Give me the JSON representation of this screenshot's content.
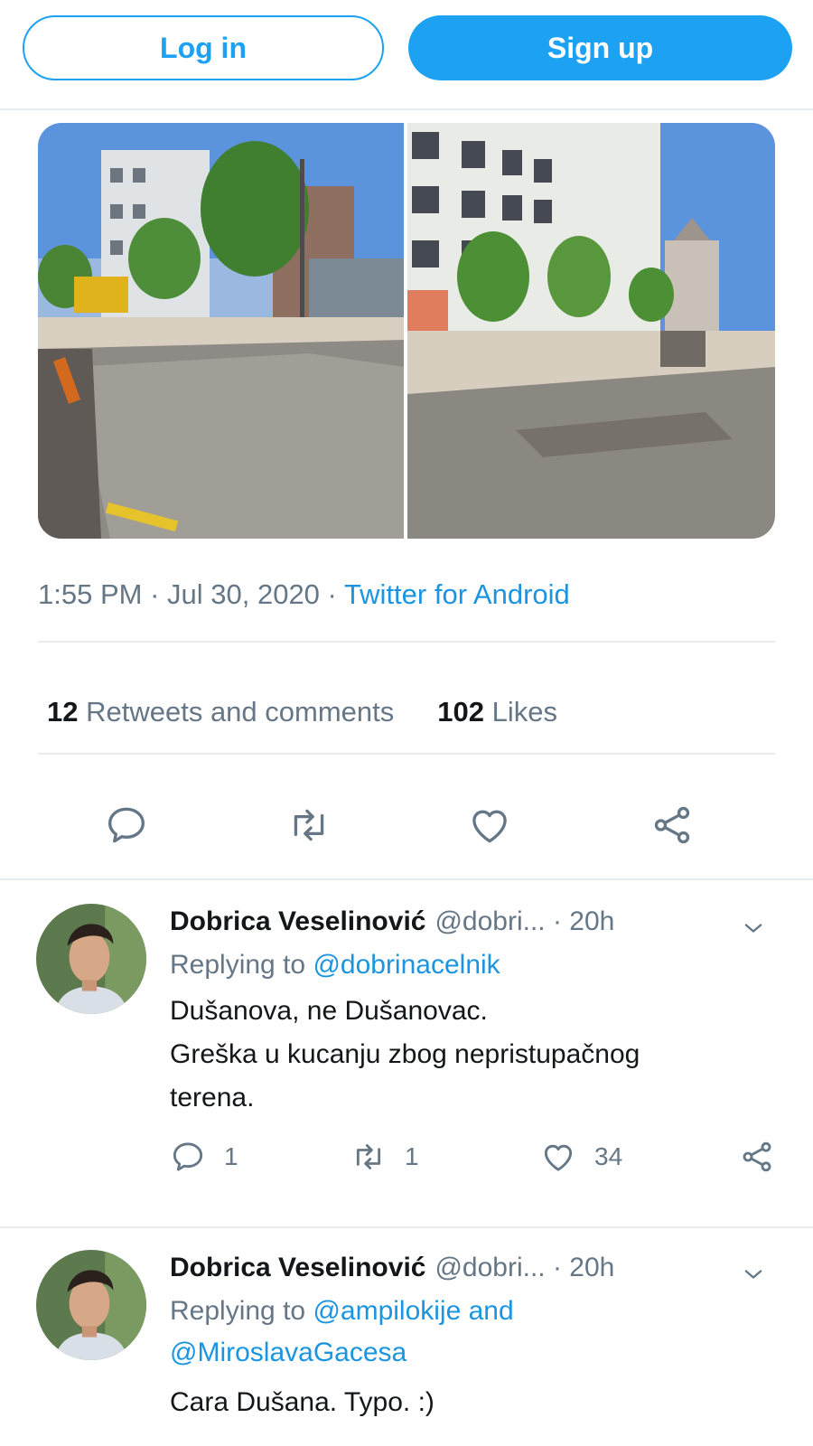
{
  "header": {
    "login_label": "Log in",
    "signup_label": "Sign up",
    "accent_color": "#1da1f2"
  },
  "tweet": {
    "time": "1:55 PM",
    "date": "Jul 30, 2020",
    "separator": " · ",
    "source": "Twitter for Android",
    "stats": {
      "retweets_count": "12",
      "retweets_label": "Retweets and comments",
      "likes_count": "102",
      "likes_label": "Likes"
    },
    "action_icons": [
      "reply-icon",
      "retweet-icon",
      "like-icon",
      "share-icon"
    ]
  },
  "replies": [
    {
      "name": "Dobrica Veselinović",
      "handle": "@dobri...",
      "time": "· 20h",
      "replying_prefix": "Replying to",
      "replying_line1": "@dobrinacelnik",
      "replying_line2": "",
      "text_lines": [
        "Dušanova, ne Dušanovac.",
        "Greška u kucanju zbog nepristupačnog",
        "terena."
      ],
      "reply_count": "1",
      "retweet_count": "1",
      "like_count": "34"
    },
    {
      "name": "Dobrica Veselinović",
      "handle": "@dobri...",
      "time": "· 20h",
      "replying_prefix": "Replying to",
      "replying_line1": "@ampilokije and",
      "replying_line2": "@MiroslavaGacesa",
      "text_lines": [
        "Cara Dušana. Typo. :)"
      ]
    }
  ]
}
